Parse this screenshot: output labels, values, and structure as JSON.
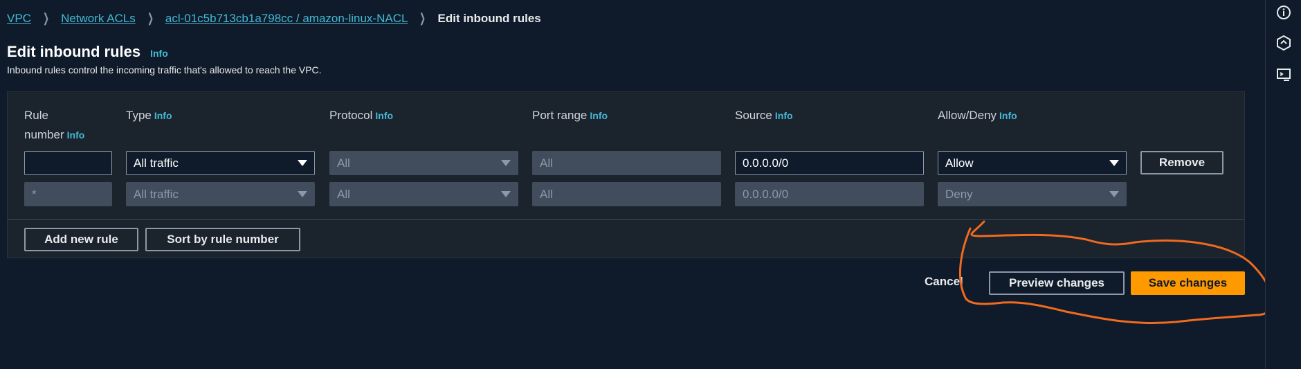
{
  "breadcrumb": {
    "items": [
      "VPC",
      "Network ACLs",
      "acl-01c5b713cb1a798cc / amazon-linux-NACL"
    ],
    "current": "Edit inbound rules"
  },
  "page": {
    "title": "Edit inbound rules",
    "info": "Info",
    "description": "Inbound rules control the incoming traffic that's allowed to reach the VPC."
  },
  "table": {
    "headers": {
      "rule_line1": "Rule",
      "rule_line2": "number",
      "type": "Type",
      "protocol": "Protocol",
      "port_range": "Port range",
      "source": "Source",
      "allow_deny": "Allow/Deny",
      "info": "Info"
    },
    "rows": [
      {
        "rule_number": "",
        "type": "All traffic",
        "protocol": "All",
        "port_range": "All",
        "source": "0.0.0.0/0",
        "allow_deny": "Allow",
        "remove_label": "Remove"
      },
      {
        "rule_number": "*",
        "type": "All traffic",
        "protocol": "All",
        "port_range": "All",
        "source": "0.0.0.0/0",
        "allow_deny": "Deny"
      }
    ]
  },
  "actions": {
    "add_rule": "Add new rule",
    "sort": "Sort by rule number",
    "cancel": "Cancel",
    "preview": "Preview changes",
    "save": "Save changes"
  },
  "colors": {
    "background": "#0f1b2a",
    "panel": "#1b232d",
    "link": "#44b9d6",
    "primary": "#ff9900",
    "annotation": "#f06a1f"
  },
  "side_rail": {
    "icons": [
      "info-icon",
      "settings-hex-icon",
      "feedback-icon"
    ]
  }
}
